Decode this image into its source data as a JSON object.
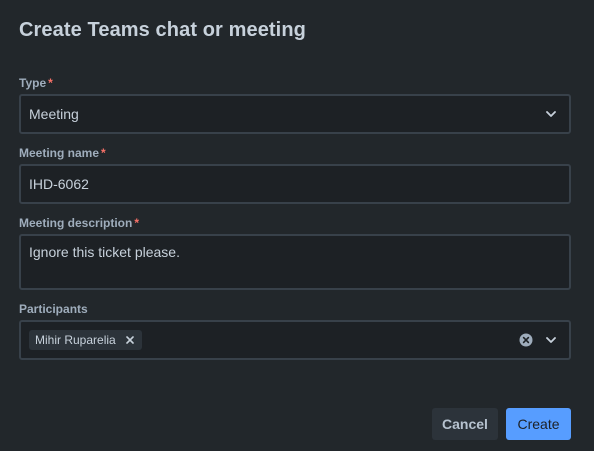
{
  "dialog": {
    "title": "Create Teams chat or meeting"
  },
  "fields": {
    "type": {
      "label": "Type",
      "required_mark": "*",
      "value": "Meeting",
      "icon": "chevron-down-icon"
    },
    "meeting_name": {
      "label": "Meeting name",
      "required_mark": "*",
      "value": "IHD-6062"
    },
    "meeting_description": {
      "label": "Meeting description",
      "required_mark": "*",
      "value": "Ignore this ticket please."
    },
    "participants": {
      "label": "Participants",
      "chips": [
        "Mihir Ruparelia"
      ],
      "clear_icon": "clear-circle-icon",
      "dropdown_icon": "chevron-down-icon"
    }
  },
  "actions": {
    "cancel_label": "Cancel",
    "create_label": "Create"
  },
  "colors": {
    "background": "#22272b",
    "field_background": "#1d2125",
    "field_border": "#38414a",
    "required": "#f87168",
    "primary": "#579dff"
  }
}
